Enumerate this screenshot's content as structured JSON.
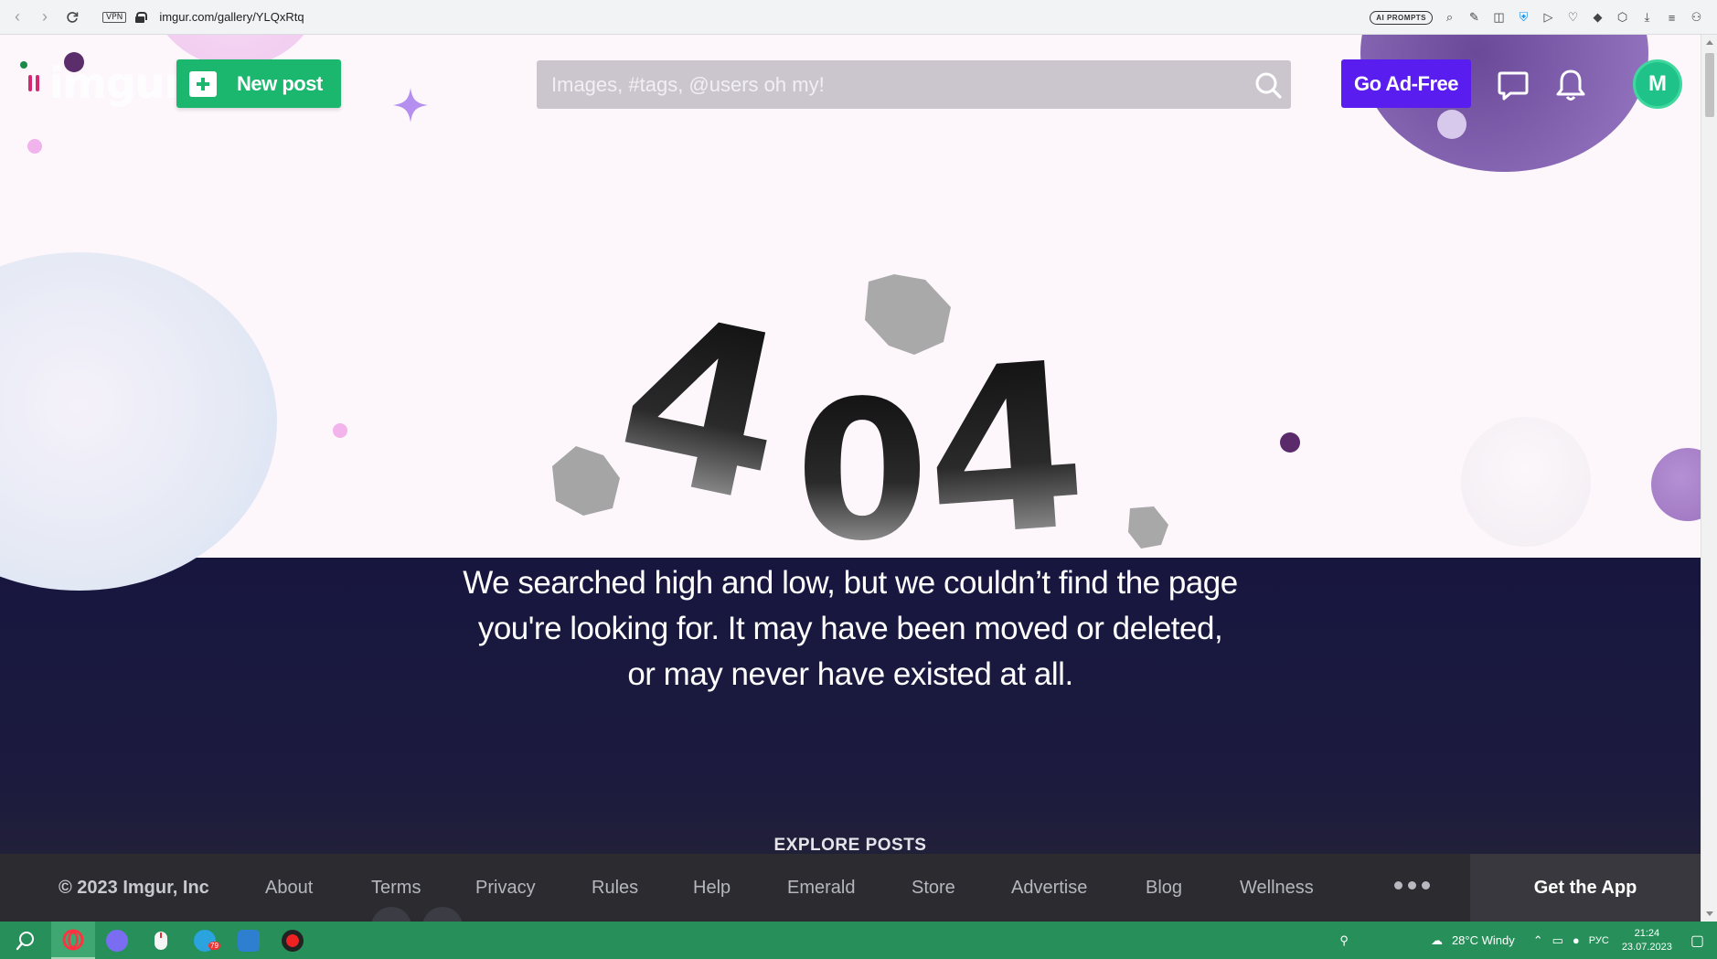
{
  "browser": {
    "url": "imgur.com/gallery/YLQxRtq",
    "vpn_label": "VPN",
    "ai_prompts_label": "AI PROMPTS"
  },
  "header": {
    "logo_text": "imgur",
    "new_post_label": "New post",
    "search_placeholder": "Images, #tags, @users oh my!",
    "ad_free_label": "Go Ad-Free",
    "avatar_letter": "M"
  },
  "error": {
    "code": "404",
    "message_lines": [
      "We searched high and low, but we couldn’t find the page",
      "you're looking for. It may have been moved or deleted,",
      "or may never have existed at all."
    ],
    "explore_label": "EXPLORE POSTS"
  },
  "footer": {
    "copyright": "© 2023 Imgur, Inc",
    "links": [
      "About",
      "Terms",
      "Privacy",
      "Rules",
      "Help",
      "Emerald",
      "Store",
      "Advertise",
      "Blog",
      "Wellness"
    ],
    "get_app_label": "Get the App"
  },
  "taskbar": {
    "weather": "28°C  Windy",
    "language": "РУС",
    "time": "21:24",
    "date": "23.07.2023",
    "telegram_badge": "79"
  },
  "colors": {
    "new_post_green": "#1bb76e",
    "ad_free_purple": "#5a1df0",
    "band_navy": "#17163f",
    "taskbar_green": "#27905a"
  }
}
